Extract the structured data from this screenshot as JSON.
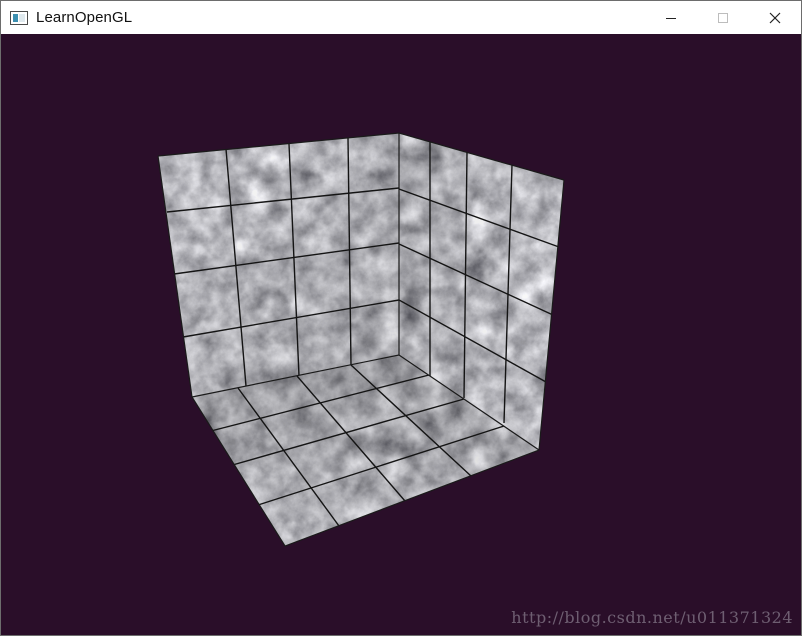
{
  "window": {
    "title": "LearnOpenGL",
    "app_icon": "window-icon"
  },
  "controls": {
    "minimize": "minimize-icon",
    "maximize": "maximize-icon",
    "close": "close-icon"
  },
  "scene": {
    "background_color": "#2a0e29",
    "object": "textured marble box interior",
    "texture_color": "#4a4a4a"
  },
  "watermark": {
    "text": "http://blog.csdn.net/u011371324"
  }
}
